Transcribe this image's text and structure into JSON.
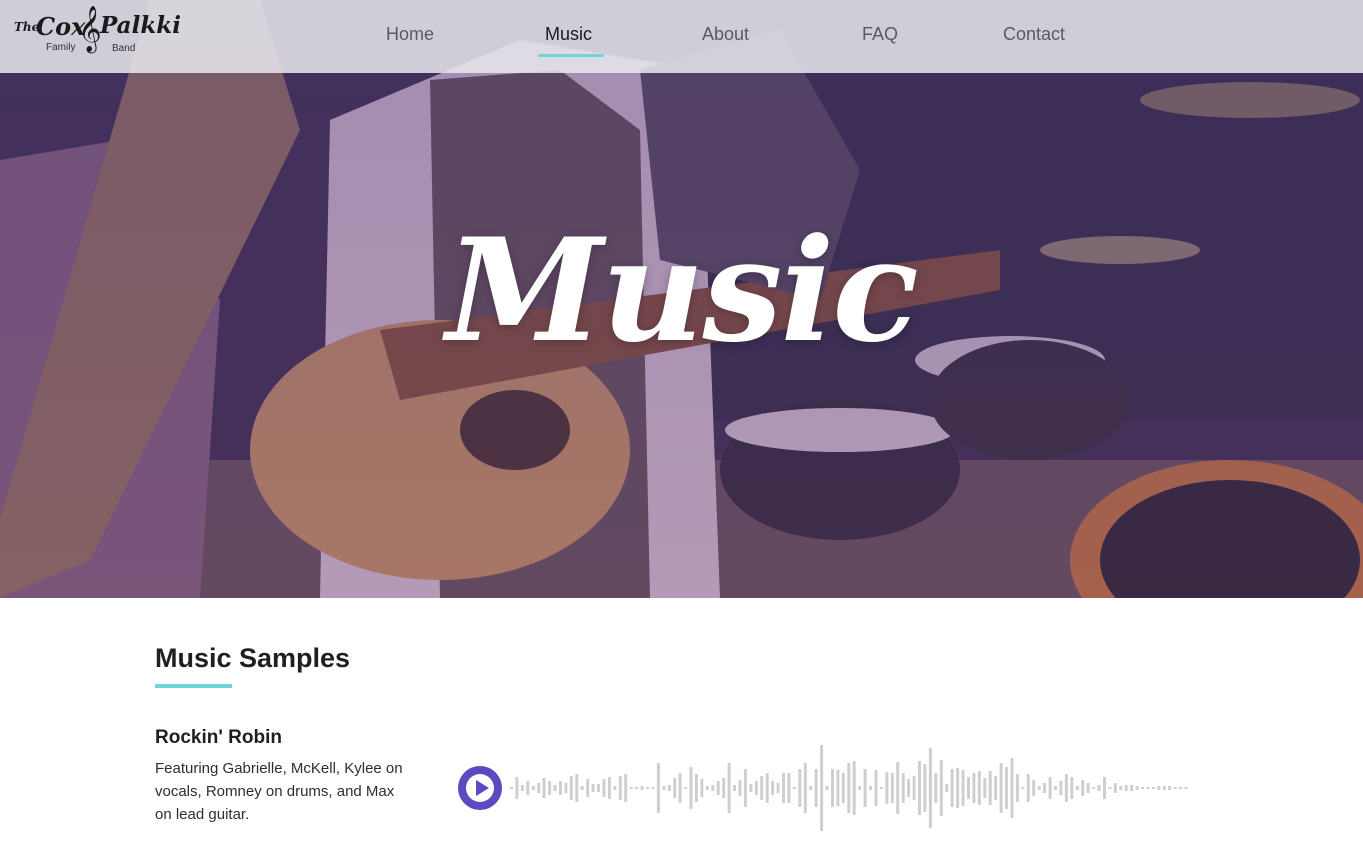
{
  "nav": {
    "logo": {
      "the": "The",
      "cox": "Cox",
      "palkki": "Palkki",
      "family": "Family",
      "band": "Band"
    },
    "items": [
      {
        "label": "Home",
        "active": false
      },
      {
        "label": "Music",
        "active": true
      },
      {
        "label": "About",
        "active": false
      },
      {
        "label": "FAQ",
        "active": false
      },
      {
        "label": "Contact",
        "active": false
      }
    ]
  },
  "hero": {
    "title": "Music"
  },
  "section": {
    "title": "Music Samples"
  },
  "track": {
    "title": "Rockin' Robin",
    "description": "Featuring Gabrielle, McKell, Kylee on vocals, Romney on drums, and Max on lead guitar.",
    "play_icon": "play-icon"
  },
  "colors": {
    "accent": "#72d3d8",
    "play": "#5a4bc0",
    "waveform": "#cfcfcf"
  }
}
